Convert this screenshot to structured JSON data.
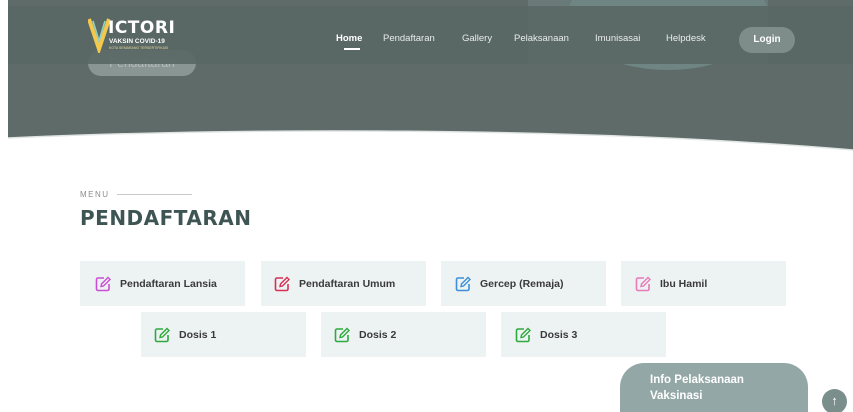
{
  "header": {
    "logo": {
      "word": "ICTORI",
      "subtitle": "VAKSIN COVID-19",
      "tagline": "KOTA SEMARANG TERSERTIFIKASI"
    },
    "hero_button_label": "Pendaftaran",
    "nav": [
      {
        "label": "Home",
        "active": true
      },
      {
        "label": "Pendaftaran",
        "active": false
      },
      {
        "label": "Gallery",
        "active": false
      },
      {
        "label": "Pelaksanaan",
        "active": false
      },
      {
        "label": "Imunisasai",
        "active": false
      },
      {
        "label": "Helpdesk",
        "active": false
      }
    ],
    "login_label": "Login"
  },
  "section": {
    "eyebrow": "MENU",
    "title": "PENDAFTARAN",
    "cards": [
      {
        "label": "Pendaftaran Lansia",
        "icon": "edit-icon",
        "color": "#c94fd6"
      },
      {
        "label": "Pendaftaran Umum",
        "icon": "edit-icon",
        "color": "#d72f56"
      },
      {
        "label": "Gercep (Remaja)",
        "icon": "edit-icon",
        "color": "#3d8fd9"
      },
      {
        "label": "Ibu Hamil",
        "icon": "edit-icon",
        "color": "#e87bb6"
      },
      {
        "label": "Dosis 1",
        "icon": "edit-icon",
        "color": "#2eaa3e"
      },
      {
        "label": "Dosis 2",
        "icon": "edit-icon",
        "color": "#2eaa3e"
      },
      {
        "label": "Dosis 3",
        "icon": "edit-icon",
        "color": "#2eaa3e"
      }
    ]
  },
  "floating": {
    "info_line1": "Info Pelaksanaan",
    "info_line2": "Vaksinasi",
    "scroll_top_icon": "arrow-up-icon"
  },
  "colors": {
    "hero": "#5e6b68",
    "title": "#3e5553",
    "card_bg": "#edf2f2",
    "accent": "#93a8a6"
  }
}
